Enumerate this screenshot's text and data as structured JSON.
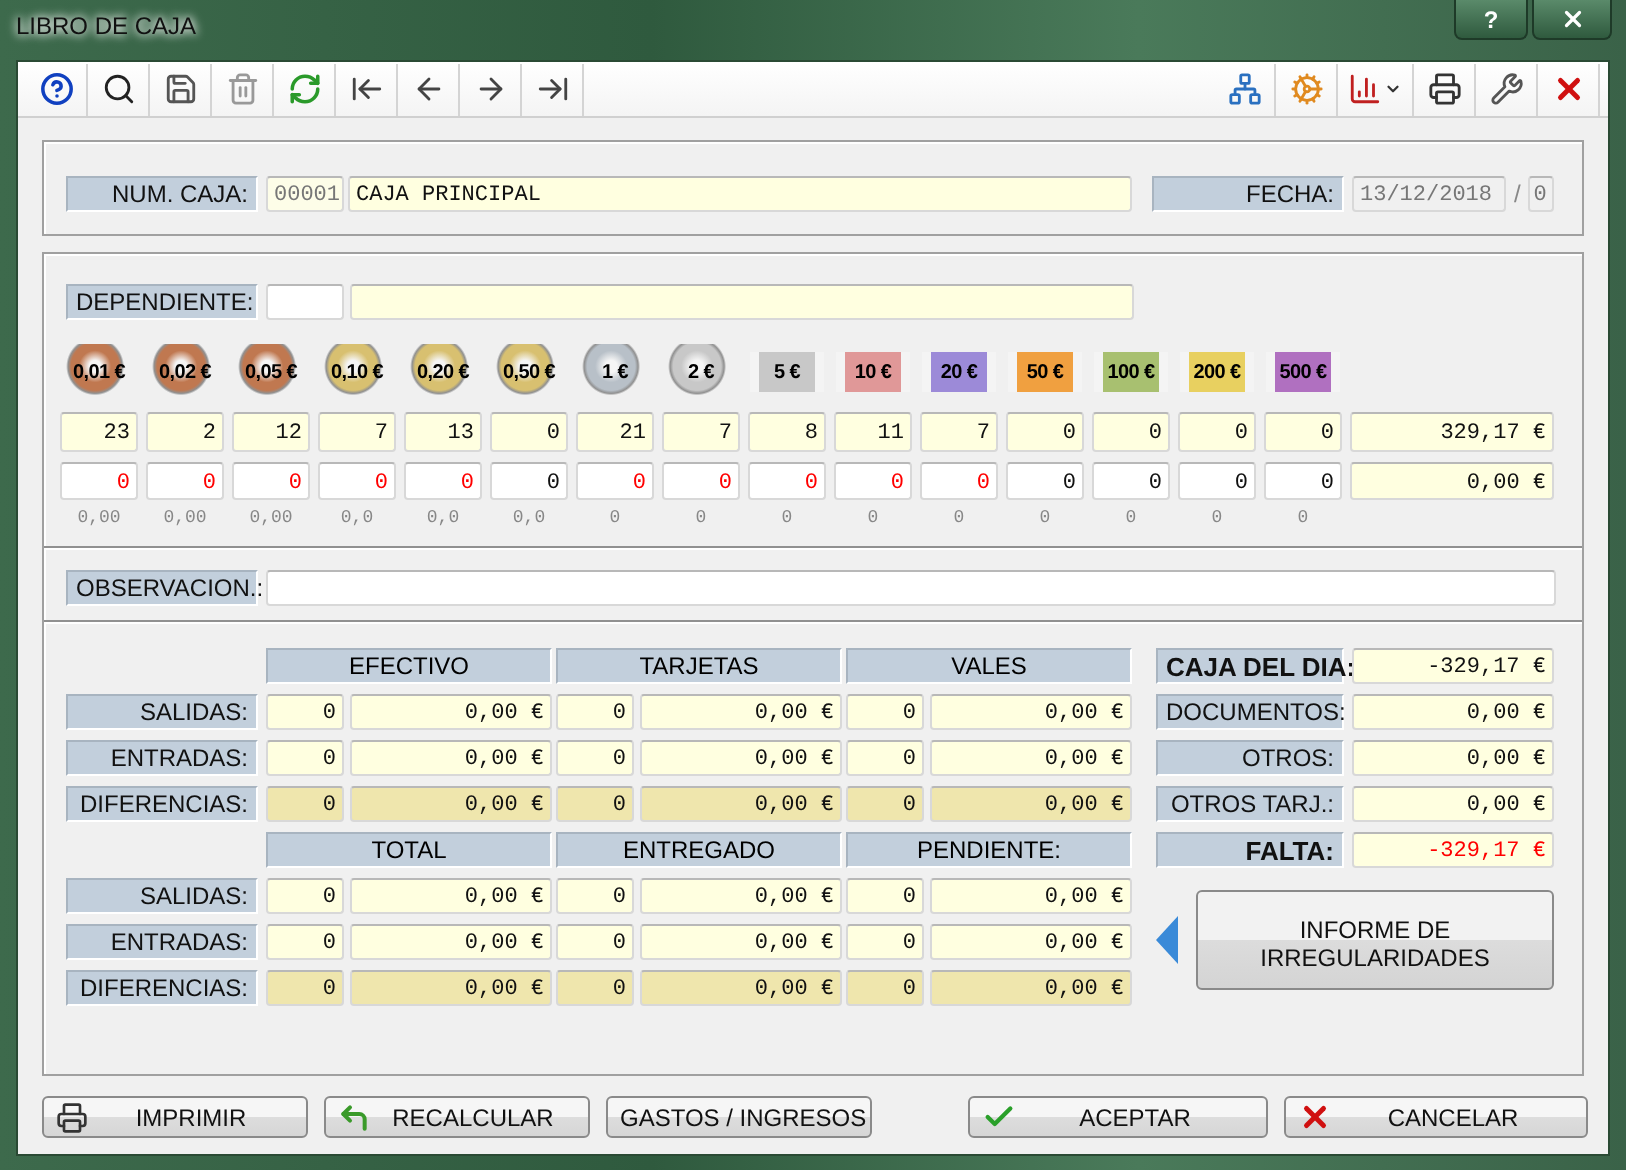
{
  "window": {
    "title": "LIBRO DE CAJA",
    "help_button": "?"
  },
  "header": {
    "caja_label": "NUM. CAJA:",
    "caja_code": "00001",
    "caja_name": "CAJA PRINCIPAL",
    "fecha_label": "FECHA:",
    "fecha": "13/12/2018",
    "separator": "/",
    "fecha_number": "0"
  },
  "dependiente": {
    "label": "DEPENDIENTE:"
  },
  "denominations": [
    {
      "label": "0,01 €",
      "kind": "coin",
      "color": "#c07850",
      "count": "23",
      "value": "0",
      "alert": true,
      "subtotal": "0,00"
    },
    {
      "label": "0,02 €",
      "kind": "coin",
      "color": "#c07850",
      "count": "2",
      "value": "0",
      "alert": true,
      "subtotal": "0,00"
    },
    {
      "label": "0,05 €",
      "kind": "coin",
      "color": "#c07850",
      "count": "12",
      "value": "0",
      "alert": true,
      "subtotal": "0,00"
    },
    {
      "label": "0,10 €",
      "kind": "coin",
      "color": "#d8c070",
      "count": "7",
      "value": "0",
      "alert": true,
      "subtotal": "0,0"
    },
    {
      "label": "0,20 €",
      "kind": "coin",
      "color": "#d8c070",
      "count": "13",
      "value": "0",
      "alert": true,
      "subtotal": "0,0"
    },
    {
      "label": "0,50 €",
      "kind": "coin",
      "color": "#d8c070",
      "count": "0",
      "value": "0",
      "alert": false,
      "subtotal": "0,0"
    },
    {
      "label": "1 €",
      "kind": "coin",
      "color": "#b8c0c8",
      "count": "21",
      "value": "0",
      "alert": true,
      "subtotal": "0"
    },
    {
      "label": "2 €",
      "kind": "coin",
      "color": "#c8c8c8",
      "count": "7",
      "value": "0",
      "alert": true,
      "subtotal": "0"
    },
    {
      "label": "5 €",
      "kind": "note",
      "color": "#c8c8c8",
      "count": "8",
      "value": "0",
      "alert": true,
      "subtotal": "0"
    },
    {
      "label": "10 €",
      "kind": "note",
      "color": "#e09898",
      "count": "11",
      "value": "0",
      "alert": true,
      "subtotal": "0"
    },
    {
      "label": "20 €",
      "kind": "note",
      "color": "#9c8ad8",
      "count": "7",
      "value": "0",
      "alert": true,
      "subtotal": "0"
    },
    {
      "label": "50 €",
      "kind": "note",
      "color": "#f0a040",
      "count": "0",
      "value": "0",
      "alert": false,
      "subtotal": "0"
    },
    {
      "label": "100 €",
      "kind": "note",
      "color": "#a8c070",
      "count": "0",
      "value": "0",
      "alert": false,
      "subtotal": "0"
    },
    {
      "label": "200 €",
      "kind": "note",
      "color": "#e8d060",
      "count": "0",
      "value": "0",
      "alert": false,
      "subtotal": "0"
    },
    {
      "label": "500 €",
      "kind": "note",
      "color": "#b070c0",
      "count": "0",
      "value": "0",
      "alert": false,
      "subtotal": "0"
    }
  ],
  "totals": {
    "count_total": "329,17 €",
    "value_total": "0,00 €"
  },
  "observacion": {
    "label": "OBSERVACION.:"
  },
  "tables": [
    {
      "columns": [
        "EFECTIVO",
        "TARJETAS",
        "VALES"
      ],
      "rows": [
        {
          "label": "SALIDAS:",
          "kind": "normal",
          "cells": [
            {
              "count": "0",
              "amount": "0,00 €"
            },
            {
              "count": "0",
              "amount": "0,00 €"
            },
            {
              "count": "0",
              "amount": "0,00 €"
            }
          ]
        },
        {
          "label": "ENTRADAS:",
          "kind": "normal",
          "cells": [
            {
              "count": "0",
              "amount": "0,00 €"
            },
            {
              "count": "0",
              "amount": "0,00 €"
            },
            {
              "count": "0",
              "amount": "0,00 €"
            }
          ]
        },
        {
          "label": "DIFERENCIAS:",
          "kind": "difference",
          "cells": [
            {
              "count": "0",
              "amount": "0,00 €"
            },
            {
              "count": "0",
              "amount": "0,00 €"
            },
            {
              "count": "0",
              "amount": "0,00 €"
            }
          ]
        }
      ]
    },
    {
      "columns": [
        "TOTAL",
        "ENTREGADO",
        "PENDIENTE:"
      ],
      "rows": [
        {
          "label": "SALIDAS:",
          "kind": "normal",
          "cells": [
            {
              "count": "0",
              "amount": "0,00 €"
            },
            {
              "count": "0",
              "amount": "0,00 €"
            },
            {
              "count": "0",
              "amount": "0,00 €"
            }
          ]
        },
        {
          "label": "ENTRADAS:",
          "kind": "normal",
          "cells": [
            {
              "count": "0",
              "amount": "0,00 €"
            },
            {
              "count": "0",
              "amount": "0,00 €"
            },
            {
              "count": "0",
              "amount": "0,00 €"
            }
          ]
        },
        {
          "label": "DIFERENCIAS:",
          "kind": "difference",
          "cells": [
            {
              "count": "0",
              "amount": "0,00 €"
            },
            {
              "count": "0",
              "amount": "0,00 €"
            },
            {
              "count": "0",
              "amount": "0,00 €"
            }
          ]
        }
      ]
    }
  ],
  "summary": [
    {
      "label": "CAJA DEL DIA:",
      "value": "-329,17 €",
      "bold": true,
      "alert": false
    },
    {
      "label": "DOCUMENTOS:",
      "value": "0,00 €",
      "bold": false,
      "alert": false
    },
    {
      "label": "OTROS:",
      "value": "0,00 €",
      "bold": false,
      "alert": false
    },
    {
      "label": "OTROS TARJ.:",
      "value": "0,00 €",
      "bold": false,
      "alert": false
    },
    {
      "label": "FALTA:",
      "value": "-329,17 €",
      "bold": true,
      "alert": true
    }
  ],
  "report_button": "INFORME DE IRREGULARIDADES",
  "buttons": [
    {
      "label": "IMPRIMIR",
      "kind": "print"
    },
    {
      "label": "RECALCULAR",
      "kind": "recalc"
    },
    {
      "label": "GASTOS / INGRESOS",
      "kind": "plain"
    },
    {
      "label": "ACEPTAR",
      "kind": "accept"
    },
    {
      "label": "CANCELAR",
      "kind": "cancel"
    }
  ]
}
